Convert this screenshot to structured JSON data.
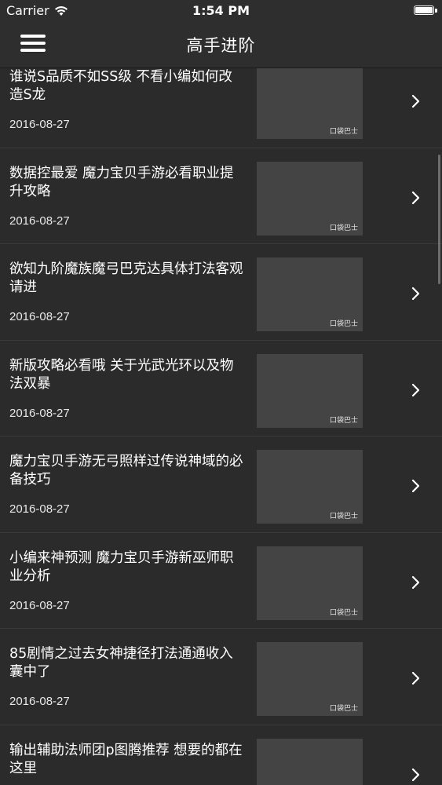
{
  "status_bar": {
    "carrier": "Carrier",
    "time": "1:54 PM"
  },
  "nav": {
    "title": "高手进阶"
  },
  "articles": [
    {
      "title": "谁说S品质不如SS级 不看小编如何改造S龙",
      "date": "2016-08-27"
    },
    {
      "title": "数据控最爱 魔力宝贝手游必看职业提升攻略",
      "date": "2016-08-27"
    },
    {
      "title": "欲知九阶魔族魔弓巴克达具体打法客观请进",
      "date": "2016-08-27"
    },
    {
      "title": "新版攻略必看哦 关于光武光环以及物法双暴",
      "date": "2016-08-27"
    },
    {
      "title": "魔力宝贝手游无弓照样过传说神域的必备技巧",
      "date": "2016-08-27"
    },
    {
      "title": "小编来神预测 魔力宝贝手游新巫师职业分析",
      "date": "2016-08-27"
    },
    {
      "title": "85剧情之过去女神捷径打法通通收入囊中了",
      "date": "2016-08-27"
    },
    {
      "title": "输出辅助法师团p图腾推荐 想要的都在这里",
      "date": ""
    }
  ],
  "thumb_watermark": "口袋巴士",
  "colors": {
    "background": "#2b2b2b",
    "nav_background": "#2e2e2e",
    "text": "#ffffff"
  }
}
